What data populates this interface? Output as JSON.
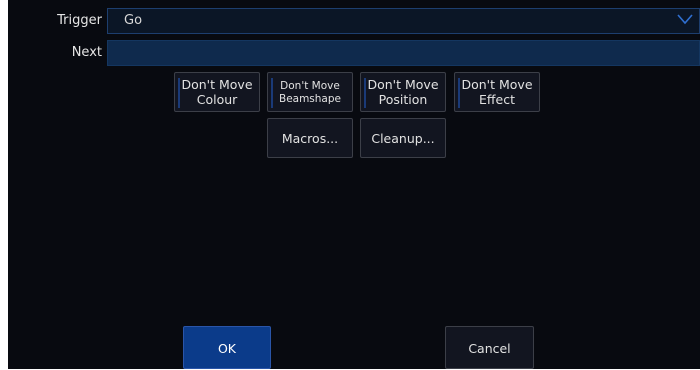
{
  "trigger": {
    "label": "Trigger",
    "value": "Go"
  },
  "next": {
    "label": "Next",
    "value": ""
  },
  "toggles": [
    {
      "line1": "Don't Move",
      "line2": "Colour"
    },
    {
      "line1": "Don't Move",
      "line2": "Beamshape"
    },
    {
      "line1": "Don't Move",
      "line2": "Position"
    },
    {
      "line1": "Don't Move",
      "line2": "Effect"
    }
  ],
  "actions": {
    "macros": "Macros...",
    "cleanup": "Cleanup..."
  },
  "footer": {
    "ok": "OK",
    "cancel": "Cancel"
  },
  "colors": {
    "panel": "#080a10",
    "accent": "#0b3b8a",
    "field": "#0f2a4d"
  }
}
